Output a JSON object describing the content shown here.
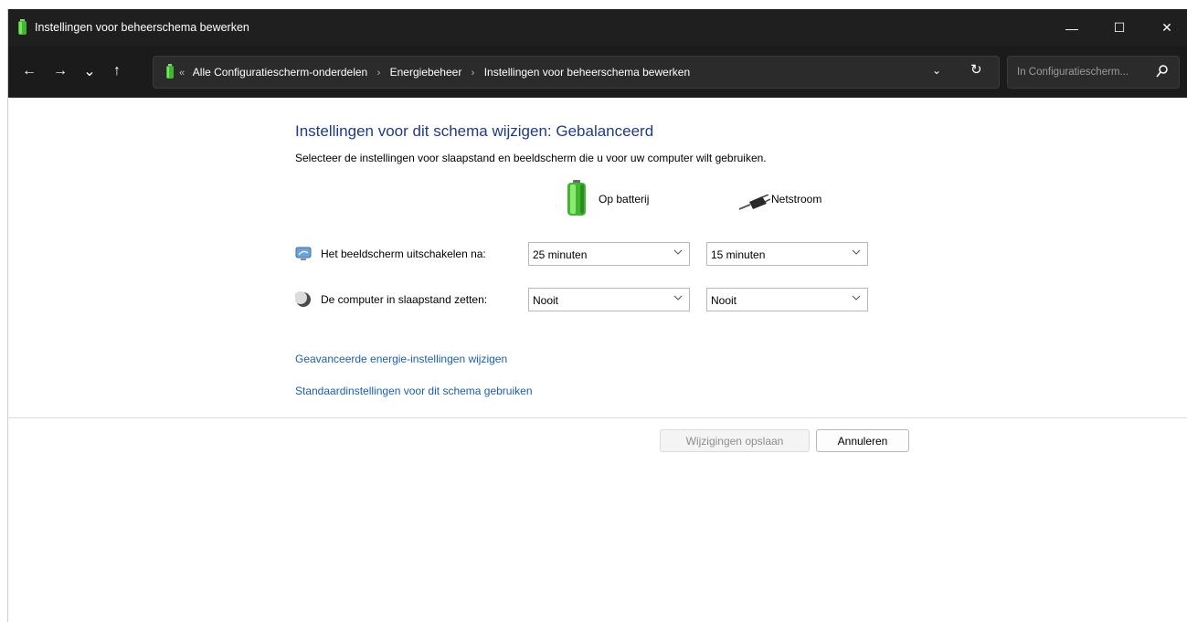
{
  "window": {
    "title": "Instellingen voor beheerschema bewerken",
    "controls": {
      "minimize": "—",
      "maximize": "☐",
      "close": "✕"
    }
  },
  "nav": {
    "back": "←",
    "forward": "→",
    "recent": "⌄",
    "up": "↑"
  },
  "address": {
    "lead": "«",
    "crumbs": [
      "Alle Configuratiescherm-onderdelen",
      "Energiebeheer",
      "Instellingen voor beheerschema bewerken"
    ],
    "separator": "›",
    "dropdown_glyph": "⌄",
    "refresh_glyph": "↻"
  },
  "search": {
    "placeholder": "In Configuratiescherm...",
    "icon": "search-icon"
  },
  "main": {
    "heading": "Instellingen voor dit schema wijzigen: Gebalanceerd",
    "subheading": "Selecteer de instellingen voor slaapstand en beeldscherm die u voor uw computer wilt gebruiken.",
    "columns": {
      "battery": {
        "label": "Op batterij",
        "icon": "battery-icon"
      },
      "ac": {
        "label": "Netstroom",
        "icon": "power-plug-icon"
      }
    },
    "rows": [
      {
        "label": "Het beeldscherm uitschakelen na:",
        "icon": "display-icon",
        "battery_value": "25 minuten",
        "ac_value": "15 minuten"
      },
      {
        "label": "De computer in slaapstand zetten:",
        "icon": "sleep-moon-icon",
        "battery_value": "Nooit",
        "ac_value": "Nooit"
      }
    ],
    "links": {
      "advanced": "Geavanceerde energie-instellingen wijzigen",
      "defaults": "Standaardinstellingen voor dit schema gebruiken"
    }
  },
  "footer": {
    "save": "Wijzigingen opslaan",
    "cancel": "Annuleren"
  },
  "colors": {
    "titlebar_bg": "#1f1f1f",
    "heading": "#1e3b8b",
    "link": "#1a5fb4",
    "battery_green": "#3fb82f"
  }
}
